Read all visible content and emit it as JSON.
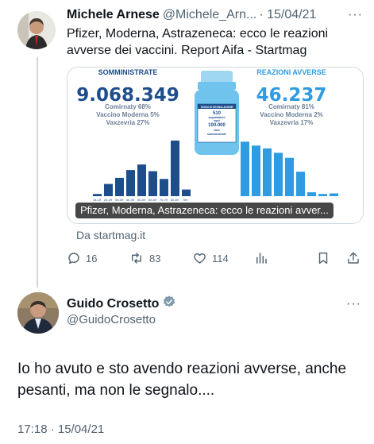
{
  "quoted_tweet": {
    "author_name": "Michele Arnese",
    "author_handle": "@Michele_Arn...",
    "date": "· 15/04/21",
    "more": "···",
    "text": "Pfizer, Moderna, Astrazeneca: ecco le reazioni avverse dei vaccini. Report Aifa - Startmag",
    "card": {
      "left_heading": "SOMMINISTRATE",
      "left_total": "9.068.349",
      "left_breakdown": [
        "Comirnaty 68%",
        "Vaccino Moderna 5%",
        "Vaxzevria 27%"
      ],
      "right_heading": "REAZIONI AVVERSE",
      "right_total": "46.237",
      "right_breakdown": [
        "Comirnaty 81%",
        "Vaccino Moderna 2%",
        "Vaxzevria 17%"
      ],
      "vial_text": [
        "TASSO DI SEGNALAZIONE",
        "510",
        "segnalazioni",
        "ogni",
        "100.000",
        "dosi",
        "somministrate"
      ],
      "age_labels": [
        "16-19",
        "20-29",
        "30-39",
        "40-49",
        "50-59",
        "60-69",
        "70-79",
        "80-89",
        "90+"
      ],
      "left_bars": [
        0.04,
        0.22,
        0.33,
        0.47,
        0.57,
        0.45,
        0.31,
        1.0,
        0.12
      ],
      "right_bars": [
        0.98,
        0.91,
        0.86,
        0.78,
        0.69,
        0.44,
        0.07,
        0.04,
        0.05
      ],
      "overlay_text": "Pfizer, Moderna, Astrazeneca: ecco le reazioni avver...",
      "colors": {
        "dark_blue": "#1e4d8c",
        "light_blue": "#2f9be0",
        "vial": "#6fc3ec"
      }
    },
    "card_source": "Da startmag.it",
    "metrics": {
      "replies": "16",
      "retweets": "83",
      "likes": "114"
    }
  },
  "main_tweet": {
    "author_name": "Guido Crosetto",
    "author_handle": "@GuidoCrosetto",
    "more": "···",
    "text": "Io ho avuto e sto avendo reazioni avverse, anche pesanti, ma non le segnalo....",
    "timestamp": "17:18 · 15/04/21"
  },
  "icons": {
    "reply": "reply-icon",
    "retweet": "retweet-icon",
    "like": "like-icon",
    "views": "views-icon",
    "bookmark": "bookmark-icon",
    "share": "share-icon",
    "verified": "verified-badge-icon"
  }
}
